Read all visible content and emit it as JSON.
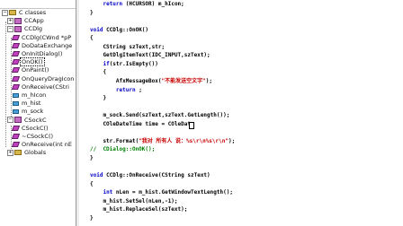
{
  "classview": {
    "nodes": [
      {
        "label": "C classes",
        "kind": "folder",
        "expanded": true
      },
      {
        "label": "CCApp",
        "kind": "cls",
        "expanded": false
      },
      {
        "label": "CCDlg",
        "kind": "cls",
        "expanded": true
      },
      {
        "label": "CCDlg(CWnd *pP",
        "kind": "fn"
      },
      {
        "label": "DoDataExchange",
        "kind": "fn"
      },
      {
        "label": "OnInitDialog()",
        "kind": "fn"
      },
      {
        "label": "OnOK()",
        "kind": "fn",
        "selected": true
      },
      {
        "label": "OnPaint()",
        "kind": "fn"
      },
      {
        "label": "OnQueryDragIcon",
        "kind": "fn"
      },
      {
        "label": "OnReceive(CStri",
        "kind": "fn"
      },
      {
        "label": "m_hIcon",
        "kind": "var"
      },
      {
        "label": "m_hist",
        "kind": "var"
      },
      {
        "label": "m_sock",
        "kind": "var"
      },
      {
        "label": "CSockC",
        "kind": "cls",
        "expanded": true
      },
      {
        "label": "CSockC()",
        "kind": "fn"
      },
      {
        "label": "~CSockC()",
        "kind": "fn"
      },
      {
        "label": "OnReceive(int nE",
        "kind": "fn"
      },
      {
        "label": "Globals",
        "kind": "folder",
        "expanded": false
      }
    ]
  },
  "editor": {
    "lines": [
      "    return (HCURSOR) m_hIcon;",
      "}",
      "",
      "void CCDlg::OnOK()",
      "{",
      "    CString szText,str;",
      "    GetDlgItemText(IDC_INPUT,szText);",
      "    if(str.IsEmpty())",
      "    {",
      "        AfxMessageBox(\"不能发送空文字\");",
      "        return ;",
      "    }",
      "",
      "    m_sock.Send(szText,szText.GetLength());",
      "    COleDateTime time = COleDate",
      "",
      "    str.Format(\"我对 所有人 说：%s\\r\\n%s\\r\\n\");",
      "//  CDialog::OnOK();",
      "}",
      "",
      "void CCDlg::OnReceive(CString szText)",
      "{",
      "    int nLen = m_hist.GetWindowTextLength();",
      "    m_hist.SetSel(nLen,-1);",
      "    m_hist.ReplaceSel(szText);",
      "}"
    ]
  }
}
